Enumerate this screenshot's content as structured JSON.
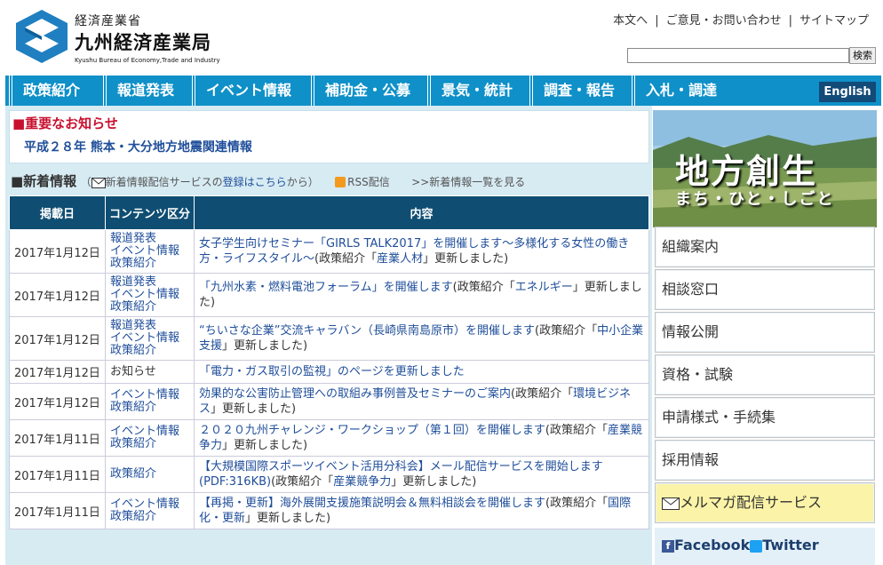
{
  "header": {
    "ministry": "経済産業省",
    "bureau": "九州経済産業局",
    "bureau_en": "Kyushu Bureau of Economy,Trade and Industry",
    "links": [
      "本文へ",
      "ご意見・お問い合わせ",
      "サイトマップ"
    ],
    "search_button": "検索",
    "search_value": ""
  },
  "nav": {
    "items": [
      "政策紹介",
      "報道発表",
      "イベント情報",
      "補助金・公募",
      "景気・統計",
      "調査・報告",
      "入札・調達"
    ],
    "english": "English"
  },
  "notice": {
    "title": "■重要なお知らせ",
    "link": "平成２８年 熊本・大分地方地震関連情報"
  },
  "news": {
    "title": "■新着情報",
    "mail_prefix": "新着情報配信サービスの",
    "mail_link": "登録はこちら",
    "mail_suffix": "から）",
    "rss": "RSS配信",
    "list_link": ">>新着情報一覧を見る",
    "columns": [
      "掲載日",
      "コンテンツ区分",
      "内容"
    ],
    "rows": [
      {
        "date": "2017年1月12日",
        "cats": [
          "報道発表",
          "イベント情報",
          "政策紹介"
        ],
        "link": "女子学生向けセミナー「GIRLS TALK2017」を開催します～多様化する女性の働き方・ライフスタイル～",
        "pre": "",
        "tag": "産業人材",
        "post": "」更新しました)"
      },
      {
        "date": "2017年1月12日",
        "cats": [
          "報道発表",
          "イベント情報",
          "政策紹介"
        ],
        "link": "「九州水素・燃料電池フォーラム」を開催します",
        "pre": "",
        "tag": "エネルギー",
        "post": "」更新しました)"
      },
      {
        "date": "2017年1月12日",
        "cats": [
          "報道発表",
          "イベント情報",
          "政策紹介"
        ],
        "link": "“ちいさな企業”交流キャラバン（長崎県南島原市）を開催します",
        "pre": "",
        "tag": "中小企業支援",
        "post": "」更新しました)"
      },
      {
        "date": "2017年1月12日",
        "cats": [
          "お知らせ"
        ],
        "link": "「電力・ガス取引の監視」のページを更新しました",
        "pre": "",
        "tag": "",
        "post": ""
      },
      {
        "date": "2017年1月12日",
        "cats": [
          "イベント情報",
          "政策紹介"
        ],
        "link": "効果的な公害防止管理への取組み事例普及セミナーのご案内",
        "pre": "",
        "tag": "環境ビジネス",
        "post": "」更新しました)"
      },
      {
        "date": "2017年1月11日",
        "cats": [
          "イベント情報",
          "政策紹介"
        ],
        "link": "２０２０九州チャレンジ・ワークショップ（第１回）を開催します",
        "pre": "",
        "tag": "産業競争力",
        "post": "」更新しました)"
      },
      {
        "date": "2017年1月11日",
        "cats": [
          "政策紹介"
        ],
        "link": "【大規模国際スポーツイベント活用分科会】メール配信サービスを開始します(PDF:316KB)",
        "pre": "",
        "tag": "産業競争力",
        "post": "」更新しました)"
      },
      {
        "date": "2017年1月11日",
        "cats": [
          "イベント情報",
          "政策紹介"
        ],
        "link": "【再掲・更新】海外展開支援施策説明会＆無料相談会を開催します",
        "pre": "",
        "tag": "国際化・更新",
        "post": "」更新しました)"
      }
    ],
    "policy_prefix": "(政策紹介「"
  },
  "sidebar": {
    "banner_title": "地方創生",
    "banner_sub": "まち・ひと・しごと",
    "buttons": [
      "組織案内",
      "相談窓口",
      "情報公開",
      "資格・試験",
      "申請様式・手続集",
      "採用情報"
    ],
    "mail": "メルマガ配信サービス",
    "facebook": "Facebook",
    "twitter": "Twitter"
  },
  "colors": {
    "nav": "#0f90c8",
    "table_head": "#0f4e72",
    "notice": "#c8102e"
  }
}
